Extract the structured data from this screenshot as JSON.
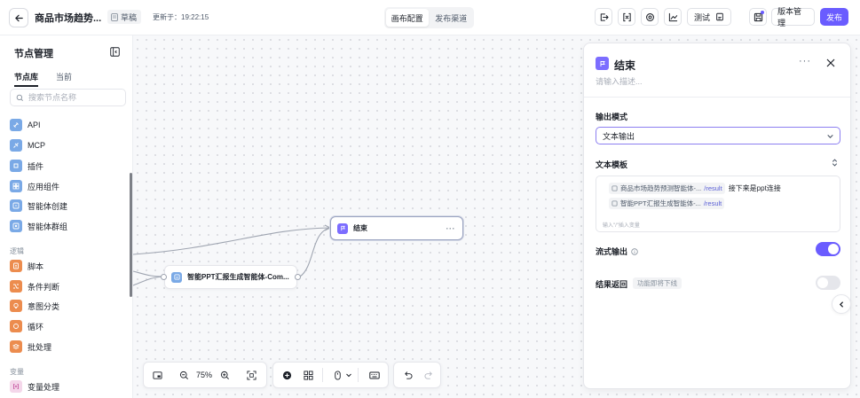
{
  "header": {
    "title": "商品市场趋势...",
    "status_badge": "草稿",
    "updated": "更新于：19:22:15",
    "tabs": [
      "画布配置",
      "发布渠道"
    ],
    "test_label": "测试",
    "version_label": "版本管理",
    "publish_label": "发布"
  },
  "sidebar": {
    "title": "节点管理",
    "tabs": [
      "节点库",
      "当前"
    ],
    "search_placeholder": "搜索节点名称",
    "items": [
      {
        "label": "API",
        "icon": "api-icon"
      },
      {
        "label": "MCP",
        "icon": "mcp-icon"
      },
      {
        "label": "插件",
        "icon": "plugin-icon"
      },
      {
        "label": "应用组件",
        "icon": "app-component-icon"
      },
      {
        "label": "智能体创建",
        "icon": "agent-create-icon"
      },
      {
        "label": "智能体群组",
        "icon": "agent-group-icon"
      }
    ],
    "logic_group": "逻辑",
    "logic_items": [
      {
        "label": "脚本",
        "icon": "script-icon"
      },
      {
        "label": "条件判断",
        "icon": "condition-icon"
      },
      {
        "label": "意图分类",
        "icon": "intent-icon"
      },
      {
        "label": "循环",
        "icon": "loop-icon"
      },
      {
        "label": "批处理",
        "icon": "batch-icon"
      }
    ],
    "variable_group": "变量",
    "variable_items": [
      {
        "label": "变量处理",
        "icon": "variable-icon"
      }
    ]
  },
  "canvas": {
    "nodes": {
      "end": {
        "label": "结束"
      },
      "ppt": {
        "label": "智能PPT汇报生成智能体-Com..."
      }
    },
    "zoom": "75%"
  },
  "panel": {
    "title": "结束",
    "description_placeholder": "请输入描述...",
    "output_mode_label": "输出模式",
    "output_mode_value": "文本输出",
    "template_label": "文本模板",
    "template": {
      "chip1_name": "商品市场趋势预测智能体-...",
      "chip1_var": "/result",
      "line1_text": "接下来是ppt连接",
      "chip2_name": "智能PPT汇报生成智能体-...",
      "chip2_var": "/result",
      "hint": "输入\"/\"插入变量"
    },
    "stream_label": "流式输出",
    "stream_on": true,
    "result_return_label": "结果返回",
    "result_return_badge": "功能即将下线",
    "result_return_on": false
  },
  "colors": {
    "accent": "#6a5cff",
    "node_blue": "#7aa9e6",
    "node_orange": "#ec8c4e"
  }
}
